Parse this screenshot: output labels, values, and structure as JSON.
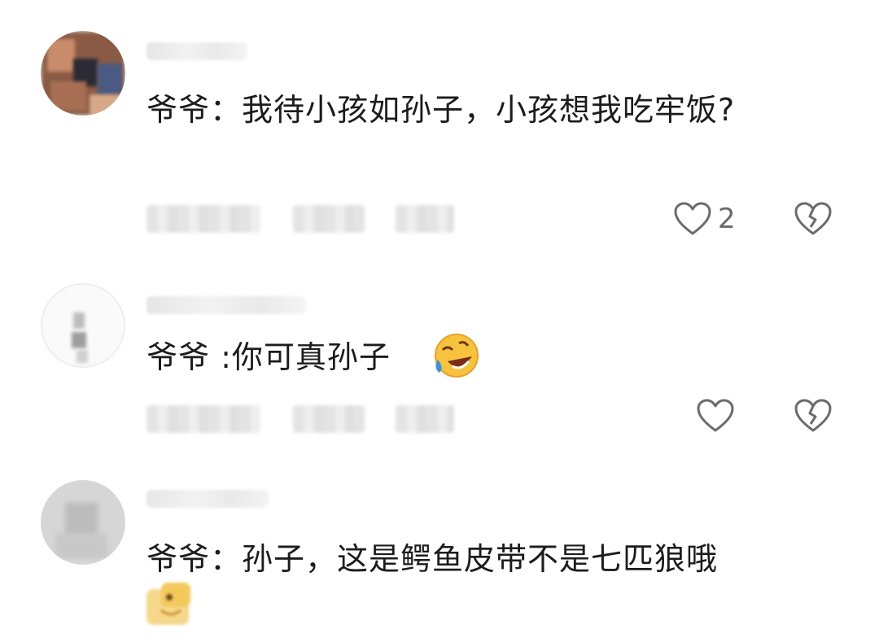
{
  "comments": [
    {
      "text": "爷爷：我待小孩如孙子，小孩想我吃牢饭?",
      "likes": "2"
    },
    {
      "text": "爷爷 :你可真孙子",
      "emoji_icon": "rolling-on-floor-laughing-emoji"
    },
    {
      "text": "爷爷：孙子，这是鳄鱼皮带不是七匹狼哦",
      "emoji_icon": "blurred-smile-emoji"
    }
  ],
  "icons": {
    "like": "heart-outline-icon",
    "dislike": "broken-heart-icon"
  },
  "colors": {
    "icon": "#6b6b6b",
    "text": "#1c1c1c",
    "blur": "#e4e4e4"
  }
}
